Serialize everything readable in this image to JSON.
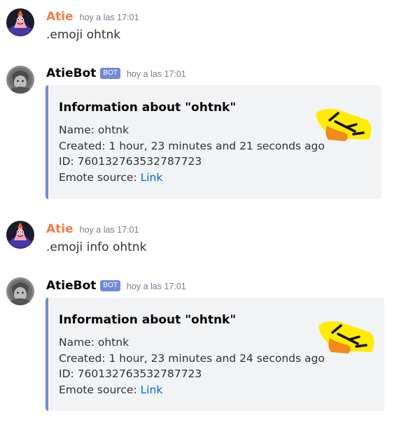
{
  "messages": [
    {
      "author": "Atie",
      "timestamp": "hoy a las 17:01",
      "content": ".emoji ohtnk"
    },
    {
      "author": "AtieBot",
      "badge": "BOT",
      "timestamp": "hoy a las 17:01",
      "embed": {
        "title": "Information about \"ohtnk\"",
        "name_label": "Name:",
        "name_value": "ohtnk",
        "created_label": "Created:",
        "created_value": "1 hour, 23 minutes and 21 seconds ago",
        "id_label": "ID:",
        "id_value": "760132763532787723",
        "source_label": "Emote source:",
        "source_link": "Link"
      }
    },
    {
      "author": "Atie",
      "timestamp": "hoy a las 17:01",
      "content": ".emoji info ohtnk"
    },
    {
      "author": "AtieBot",
      "badge": "BOT",
      "timestamp": "hoy a las 17:01",
      "embed": {
        "title": "Information about \"ohtnk\"",
        "name_label": "Name:",
        "name_value": "ohtnk",
        "created_label": "Created:",
        "created_value": "1 hour, 23 minutes and 24 seconds ago",
        "id_label": "ID:",
        "id_value": "760132763532787723",
        "source_label": "Emote source:",
        "source_link": "Link"
      }
    }
  ],
  "colors": {
    "user_name": "#f47b4a",
    "bot_badge": "#7289da",
    "embed_border": "#7289da",
    "embed_bg": "#f2f3f5",
    "link": "#0068e0"
  }
}
